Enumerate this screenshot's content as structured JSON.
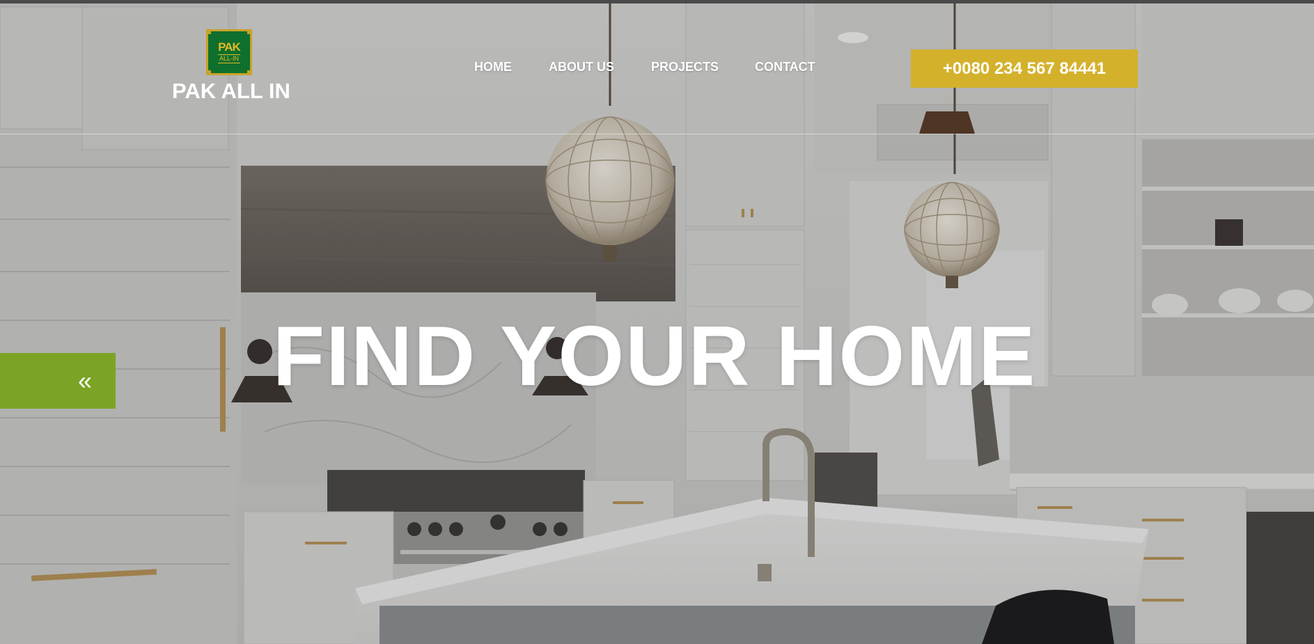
{
  "brand": {
    "logo_line1": "PAK",
    "logo_line2": "ALL-IN",
    "name": "PAK ALL IN",
    "logo_color": "#0f6f2c",
    "logo_accent": "#c9a227"
  },
  "nav": {
    "items": [
      {
        "label": "HOME"
      },
      {
        "label": "ABOUT US"
      },
      {
        "label": "PROJECTS"
      },
      {
        "label": "CONTACT"
      }
    ]
  },
  "contact": {
    "phone": "+0080 234 567 84441",
    "button_color": "#d4b12b"
  },
  "hero": {
    "title": "FIND YOUR HOME",
    "prev_icon": "«",
    "prev_color": "#7ba426"
  }
}
